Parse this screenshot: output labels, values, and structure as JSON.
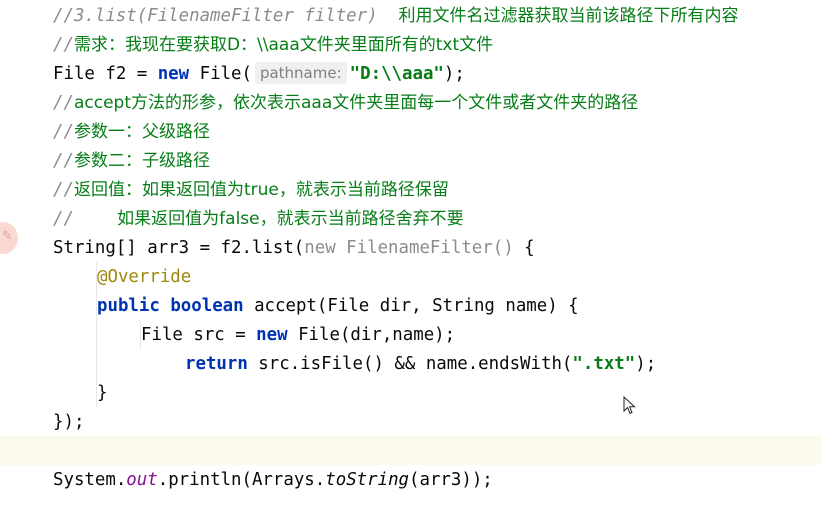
{
  "editor": {
    "lines": [
      {
        "comment_prefix": "//3.list(FilenameFilter filter)  ",
        "comment_text": "利用文件名过滤器获取当前该路径下所有内容"
      },
      {
        "comment_prefix": "//",
        "comment_text": "需求：我现在要获取D：\\\\aaa文件夹里面所有的txt文件"
      },
      {
        "type_a": "File f2 = ",
        "kw_new": "new",
        "call": " File(",
        "hint": "pathname:",
        "string": "\"D:\\\\aaa\"",
        "end": ");"
      },
      {
        "comment_prefix": "//",
        "comment_text": "accept方法的形参，依次表示aaa文件夹里面每一个文件或者文件夹的路径"
      },
      {
        "comment_prefix": "//",
        "comment_text": "参数一：父级路径"
      },
      {
        "comment_prefix": "//",
        "comment_text": "参数二：子级路径"
      },
      {
        "comment_prefix": "//",
        "comment_text": "返回值：如果返回值为true，就表示当前路径保留"
      },
      {
        "comment_prefix": "//",
        "comment_text": "        如果返回值为false，就表示当前路径舍弃不要"
      },
      {
        "pre": "String[] arr3 = f2.list(",
        "gray": "new FilenameFilter() ",
        "post": "{"
      },
      {
        "annotation": "@Override"
      },
      {
        "kw1": "public",
        "kw2": "boolean",
        "rest": " accept(File dir, String name) {"
      },
      {
        "pre": "File src = ",
        "kw": "new",
        "post": " File(dir,name);"
      },
      {
        "kw": "return",
        "pre": " src.isFile() && name.endsWith(",
        "string": "\".txt\"",
        "post": ");"
      },
      {
        "text": "}"
      },
      {
        "text": "});"
      },
      {
        "text": ""
      },
      {
        "pre": "System.",
        "field": "out",
        "mid": ".println(Arrays.",
        "static_call": "toString",
        "post": "(arr3));"
      }
    ],
    "gutter_icon": "bulb-icon",
    "cursor_icon": "mouse-pointer-icon"
  },
  "colors": {
    "keyword": "#0033b3",
    "string": "#067d17",
    "comment": "#8c8c8c",
    "annotation": "#9e880d",
    "field": "#871094"
  }
}
